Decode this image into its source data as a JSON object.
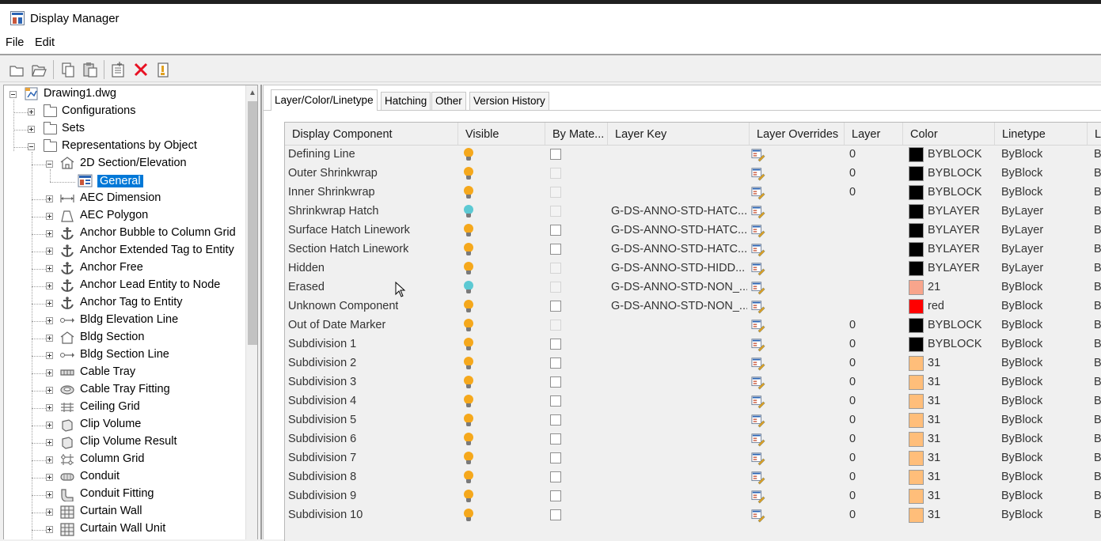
{
  "window": {
    "title": "Display Manager"
  },
  "menu": {
    "file": "File",
    "edit": "Edit"
  },
  "toolbar": {
    "buttons": [
      "new-icon",
      "open-icon",
      "copy-icon",
      "paste-icon",
      "new-set-icon",
      "delete-icon",
      "purge-icon"
    ]
  },
  "tree": {
    "root": "Drawing1.dwg",
    "configurations": "Configurations",
    "sets": "Sets",
    "representations": "Representations by Object",
    "section_elevation": "2D Section/Elevation",
    "general": "General",
    "objects": [
      "AEC Dimension",
      "AEC Polygon",
      "Anchor Bubble to Column Grid",
      "Anchor Extended Tag to Entity",
      "Anchor Free",
      "Anchor Lead Entity to Node",
      "Anchor Tag to Entity",
      "Bldg Elevation Line",
      "Bldg Section",
      "Bldg Section Line",
      "Cable Tray",
      "Cable Tray Fitting",
      "Ceiling Grid",
      "Clip Volume",
      "Clip Volume Result",
      "Column Grid",
      "Conduit",
      "Conduit Fitting",
      "Curtain Wall",
      "Curtain Wall Unit"
    ]
  },
  "tabs": [
    "Layer/Color/Linetype",
    "Hatching",
    "Other",
    "Version History"
  ],
  "grid": {
    "columns": [
      "Display Component",
      "Visible",
      "By Mate...",
      "Layer Key",
      "Layer Overrides",
      "Layer",
      "Color",
      "Linetype",
      "L"
    ],
    "rows": [
      {
        "name": "Defining Line",
        "visible": "on",
        "bymat": "enabled",
        "layerkey": "",
        "layer": "0",
        "colorHex": "#000000",
        "color": "BYBLOCK",
        "linetype": "ByBlock",
        "extra": "By"
      },
      {
        "name": "Outer Shrinkwrap",
        "visible": "on",
        "bymat": "disabled",
        "layerkey": "",
        "layer": "0",
        "colorHex": "#000000",
        "color": "BYBLOCK",
        "linetype": "ByBlock",
        "extra": "By"
      },
      {
        "name": "Inner Shrinkwrap",
        "visible": "on",
        "bymat": "disabled",
        "layerkey": "",
        "layer": "0",
        "colorHex": "#000000",
        "color": "BYBLOCK",
        "linetype": "ByBlock",
        "extra": "By"
      },
      {
        "name": "Shrinkwrap Hatch",
        "visible": "off",
        "bymat": "disabled",
        "layerkey": "G-DS-ANNO-STD-HATC...",
        "layer": "",
        "colorHex": "#000000",
        "color": "BYLAYER",
        "linetype": "ByLayer",
        "extra": "By"
      },
      {
        "name": "Surface Hatch Linework",
        "visible": "on",
        "bymat": "enabled",
        "layerkey": "G-DS-ANNO-STD-HATC...",
        "layer": "",
        "colorHex": "#000000",
        "color": "BYLAYER",
        "linetype": "ByLayer",
        "extra": "By"
      },
      {
        "name": "Section Hatch Linework",
        "visible": "on",
        "bymat": "enabled",
        "layerkey": "G-DS-ANNO-STD-HATC...",
        "layer": "",
        "colorHex": "#000000",
        "color": "BYLAYER",
        "linetype": "ByLayer",
        "extra": "By"
      },
      {
        "name": "Hidden",
        "visible": "on",
        "bymat": "disabled",
        "layerkey": "G-DS-ANNO-STD-HIDD...",
        "layer": "",
        "colorHex": "#000000",
        "color": "BYLAYER",
        "linetype": "ByLayer",
        "extra": "By"
      },
      {
        "name": "Erased",
        "visible": "off",
        "bymat": "disabled",
        "layerkey": "G-DS-ANNO-STD-NON_...",
        "layer": "",
        "colorHex": "#f8a58c",
        "color": "21",
        "linetype": "ByBlock",
        "extra": "By"
      },
      {
        "name": "Unknown Component",
        "visible": "on",
        "bymat": "enabled",
        "layerkey": "G-DS-ANNO-STD-NON_...",
        "layer": "",
        "colorHex": "#ff0000",
        "color": "red",
        "linetype": "ByBlock",
        "extra": "By"
      },
      {
        "name": "Out of Date Marker",
        "visible": "on",
        "bymat": "disabled",
        "layerkey": "",
        "layer": "0",
        "colorHex": "#000000",
        "color": "BYBLOCK",
        "linetype": "ByBlock",
        "extra": "By"
      },
      {
        "name": "Subdivision 1",
        "visible": "on",
        "bymat": "enabled",
        "layerkey": "",
        "layer": "0",
        "colorHex": "#000000",
        "color": "BYBLOCK",
        "linetype": "ByBlock",
        "extra": "By"
      },
      {
        "name": "Subdivision 2",
        "visible": "on",
        "bymat": "enabled",
        "layerkey": "",
        "layer": "0",
        "colorHex": "#ffbe7a",
        "color": "31",
        "linetype": "ByBlock",
        "extra": "By"
      },
      {
        "name": "Subdivision 3",
        "visible": "on",
        "bymat": "enabled",
        "layerkey": "",
        "layer": "0",
        "colorHex": "#ffbe7a",
        "color": "31",
        "linetype": "ByBlock",
        "extra": "By"
      },
      {
        "name": "Subdivision 4",
        "visible": "on",
        "bymat": "enabled",
        "layerkey": "",
        "layer": "0",
        "colorHex": "#ffbe7a",
        "color": "31",
        "linetype": "ByBlock",
        "extra": "By"
      },
      {
        "name": "Subdivision 5",
        "visible": "on",
        "bymat": "enabled",
        "layerkey": "",
        "layer": "0",
        "colorHex": "#ffbe7a",
        "color": "31",
        "linetype": "ByBlock",
        "extra": "By"
      },
      {
        "name": "Subdivision 6",
        "visible": "on",
        "bymat": "enabled",
        "layerkey": "",
        "layer": "0",
        "colorHex": "#ffbe7a",
        "color": "31",
        "linetype": "ByBlock",
        "extra": "By"
      },
      {
        "name": "Subdivision 7",
        "visible": "on",
        "bymat": "enabled",
        "layerkey": "",
        "layer": "0",
        "colorHex": "#ffbe7a",
        "color": "31",
        "linetype": "ByBlock",
        "extra": "By"
      },
      {
        "name": "Subdivision 8",
        "visible": "on",
        "bymat": "enabled",
        "layerkey": "",
        "layer": "0",
        "colorHex": "#ffbe7a",
        "color": "31",
        "linetype": "ByBlock",
        "extra": "By"
      },
      {
        "name": "Subdivision 9",
        "visible": "on",
        "bymat": "enabled",
        "layerkey": "",
        "layer": "0",
        "colorHex": "#ffbe7a",
        "color": "31",
        "linetype": "ByBlock",
        "extra": "By"
      },
      {
        "name": "Subdivision 10",
        "visible": "on",
        "bymat": "enabled",
        "layerkey": "",
        "layer": "0",
        "colorHex": "#ffbe7a",
        "color": "31",
        "linetype": "ByBlock",
        "extra": "By"
      }
    ]
  },
  "colors": {
    "bulb_on": "#f5a81c",
    "bulb_off": "#5cc9d3",
    "selection": "#0078d7",
    "delete": "#e81123"
  }
}
